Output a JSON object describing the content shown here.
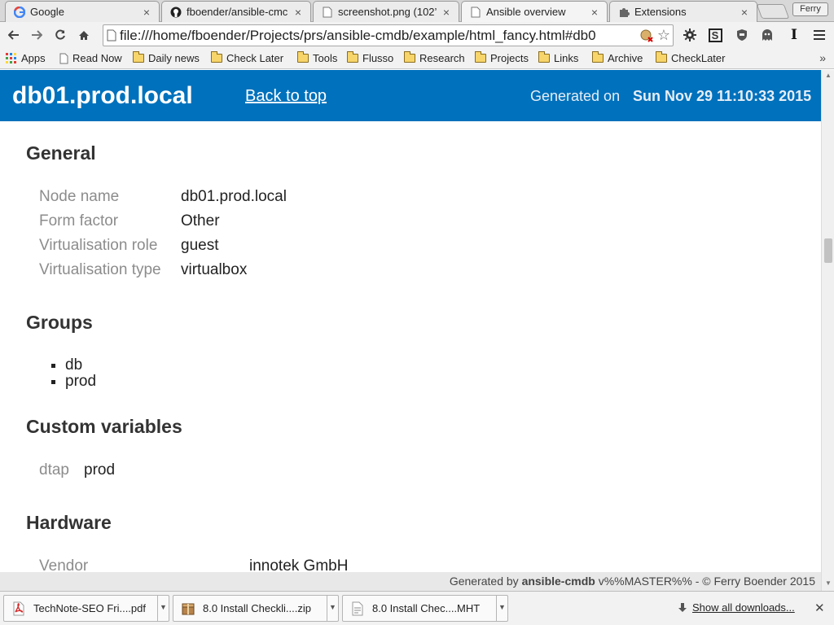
{
  "browser": {
    "tabs": [
      {
        "title": "Google",
        "favicon": "google-icon"
      },
      {
        "title": "fboender/ansible-cmc",
        "favicon": "github-icon"
      },
      {
        "title": "screenshot.png (102’",
        "favicon": "page-icon"
      },
      {
        "title": "Ansible overview",
        "favicon": "page-icon"
      },
      {
        "title": "Extensions",
        "favicon": "puzzle-icon"
      }
    ],
    "profile_name": "Ferry",
    "url": "file:///home/fboender/Projects/prs/ansible-cmdb/example/html_fancy.html#db0",
    "bookmarks": [
      {
        "label": "Apps",
        "icon": "apps-grid-icon"
      },
      {
        "label": "Read Now",
        "icon": "page-icon"
      },
      {
        "label": "Daily news",
        "icon": "folder-icon"
      },
      {
        "label": "Check Later",
        "icon": "folder-icon"
      },
      {
        "label": "Tools",
        "icon": "folder-icon"
      },
      {
        "label": "Flusso",
        "icon": "folder-icon"
      },
      {
        "label": "Research",
        "icon": "folder-icon"
      },
      {
        "label": "Projects",
        "icon": "folder-icon"
      },
      {
        "label": "Links",
        "icon": "folder-icon"
      },
      {
        "label": "Archive",
        "icon": "folder-icon"
      },
      {
        "label": "CheckLater",
        "icon": "folder-icon"
      }
    ],
    "bookmarks_overflow": "»"
  },
  "page": {
    "header": {
      "host": "db01.prod.local",
      "back_to_top": "Back to top",
      "generated_label": "Generated on",
      "generated_date": "Sun Nov 29 11:10:33 2015"
    },
    "general": {
      "title": "General",
      "rows": [
        {
          "key": "Node name",
          "value": "db01.prod.local"
        },
        {
          "key": "Form factor",
          "value": "Other"
        },
        {
          "key": "Virtualisation role",
          "value": "guest"
        },
        {
          "key": "Virtualisation type",
          "value": "virtualbox"
        }
      ]
    },
    "groups": {
      "title": "Groups",
      "items": [
        "db",
        "prod"
      ]
    },
    "custom_variables": {
      "title": "Custom variables",
      "rows": [
        {
          "key": "dtap",
          "value": "prod"
        }
      ]
    },
    "hardware": {
      "title": "Hardware",
      "rows": [
        {
          "key": "Vendor",
          "value": "innotek GmbH"
        }
      ]
    },
    "footer": {
      "prefix": "Generated by ",
      "tool": "ansible-cmdb",
      "suffix": " v%%MASTER%% - © Ferry Boender 2015"
    }
  },
  "downloads": {
    "items": [
      {
        "label": "TechNote-SEO Fri....pdf",
        "icon": "pdf-file-icon"
      },
      {
        "label": "8.0 Install Checkli....zip",
        "icon": "archive-file-icon"
      },
      {
        "label": "8.0 Install Chec....MHT",
        "icon": "mht-file-icon"
      }
    ],
    "show_all": "Show all downloads..."
  },
  "colors": {
    "header_bg": "#0071bc",
    "key_text": "#8c8c8c"
  }
}
